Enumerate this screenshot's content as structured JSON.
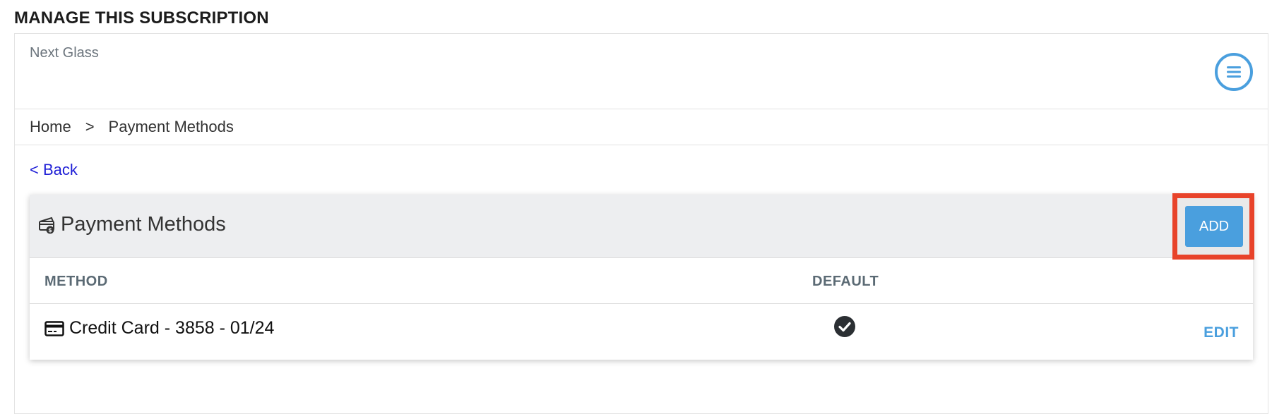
{
  "page": {
    "title": "MANAGE THIS SUBSCRIPTION"
  },
  "brand": {
    "name": "Next Glass",
    "menu_icon": "hamburger-menu-icon"
  },
  "breadcrumb": {
    "items": [
      "Home",
      "Payment Methods"
    ],
    "separator": ">"
  },
  "back_link": "< Back",
  "card": {
    "title": "Payment Methods",
    "title_icon": "payment-methods-icon",
    "add_label": "ADD",
    "highlight_color": "#e8432a",
    "accent_color": "#4a9fde"
  },
  "table": {
    "headers": {
      "method": "METHOD",
      "default": "DEFAULT"
    },
    "rows": [
      {
        "method_icon": "credit-card-icon",
        "method": "Credit Card - 3858 - 01/24",
        "default": true,
        "default_icon": "check-circle-icon",
        "action": "EDIT"
      }
    ]
  }
}
